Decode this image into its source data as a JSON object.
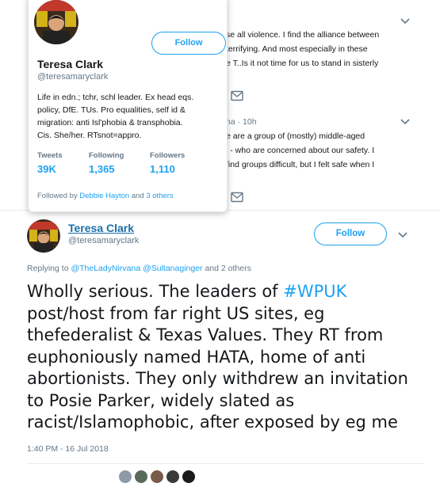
{
  "background_tweet_1": {
    "lines": [
      "se all violence. I find the alliance between",
      "terrifying. And most especially in these",
      "e T..Is it not time for us to stand in sisterly"
    ]
  },
  "background_tweet_2": {
    "meta": "na · 10h",
    "lines": [
      "e are a group of (mostly) middle-aged",
      "l - who are concerned about our safety. I",
      "find groups difficult, but I felt safe when I"
    ]
  },
  "hover_card": {
    "name": "Teresa Clark",
    "handle": "@teresamaryclark",
    "follow_label": "Follow",
    "bio_lines": [
      "Life in edn.; tchr, schl leader. Ex head eqs.",
      "policy, DfE. TUs. Pro equalities, self id &",
      "migration: anti Isl'phobia & transphobia.",
      "Cis. She/her. RTsnot=appro."
    ],
    "stats": [
      {
        "label": "Tweets",
        "value": "39K"
      },
      {
        "label": "Following",
        "value": "1,365"
      },
      {
        "label": "Followers",
        "value": "1,110"
      }
    ],
    "followed_by_prefix": "Followed by ",
    "followed_by_name": "Debbie Hayton",
    "followed_by_and": " and ",
    "followed_by_others": "3 others"
  },
  "main_tweet": {
    "name": "Teresa Clark",
    "handle": "@teresamaryclark",
    "follow_label": "Follow",
    "replying_prefix": "Replying to ",
    "replying_user1": "@TheLadyNirvana",
    "replying_user2": "@Sultanaginger",
    "replying_suffix": " and 2 others",
    "text_before_hashtag": "Wholly serious. The leaders of ",
    "hashtag": "#WPUK",
    "text_lines": [
      "post/host from far right US sites, eg",
      "thefederalist & Texas Values. They RT from",
      "euphoniously named HATA, home of anti",
      "abortionists. They only withdrew an invitation",
      "to Posie Parker, widely slated as",
      "racist/Islamophobic, after exposed by eg me"
    ],
    "timestamp": "1:40 PM - 16 Jul 2018"
  },
  "colors": {
    "accent": "#1da1f2",
    "muted": "#657786",
    "text": "#14171a",
    "border": "#e1e8ed"
  },
  "icons": [
    "chevron-down-icon",
    "envelope-icon"
  ]
}
